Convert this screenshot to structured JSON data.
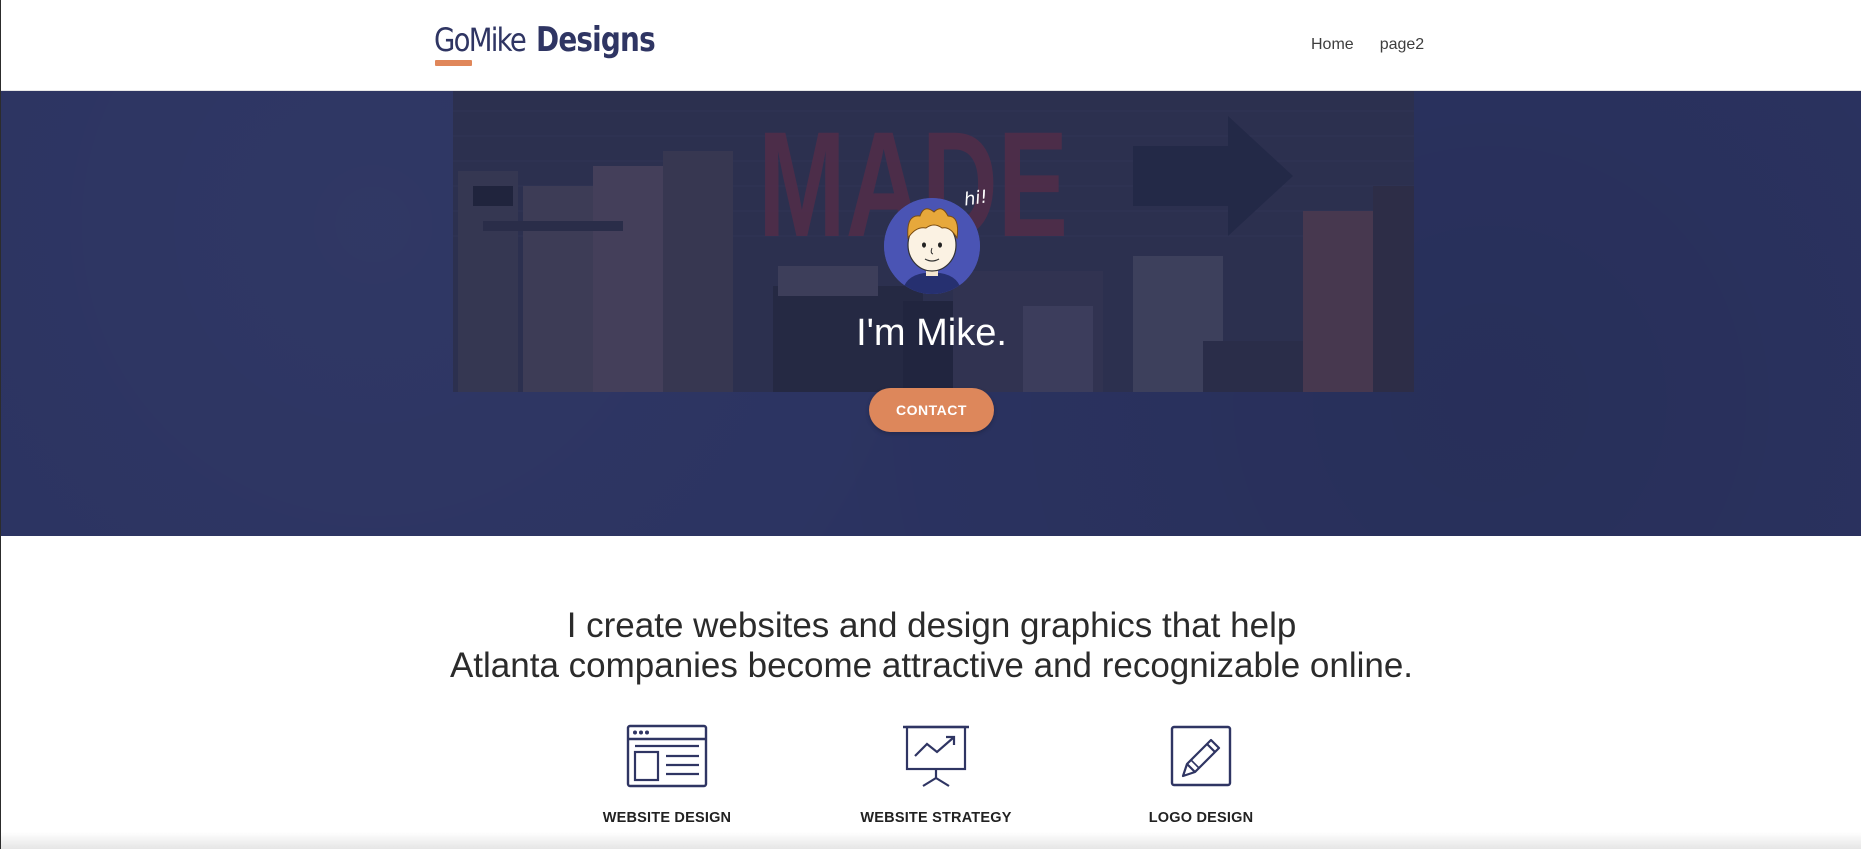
{
  "header": {
    "logo_part1": "GoMike",
    "logo_part2": "Designs",
    "nav": [
      {
        "label": "Home"
      },
      {
        "label": "page2"
      }
    ]
  },
  "hero": {
    "avatar_bubble": "hi!",
    "title": "I'm Mike.",
    "contact_label": "CONTACT",
    "photo_wall_text": "MADE"
  },
  "intro": {
    "line1": "I create websites and design graphics that help",
    "line2": "Atlanta companies become attractive and recognizable online."
  },
  "services": [
    {
      "label": "WEBSITE DESIGN",
      "icon": "browser-window-icon"
    },
    {
      "label": "WEBSITE STRATEGY",
      "icon": "presentation-chart-icon"
    },
    {
      "label": "LOGO DESIGN",
      "icon": "pencil-edit-icon"
    }
  ],
  "colors": {
    "brand_navy": "#2f3563",
    "hero_bg": "#2b3361",
    "accent_orange": "#dd875b",
    "avatar_bg": "#4a54b4"
  }
}
